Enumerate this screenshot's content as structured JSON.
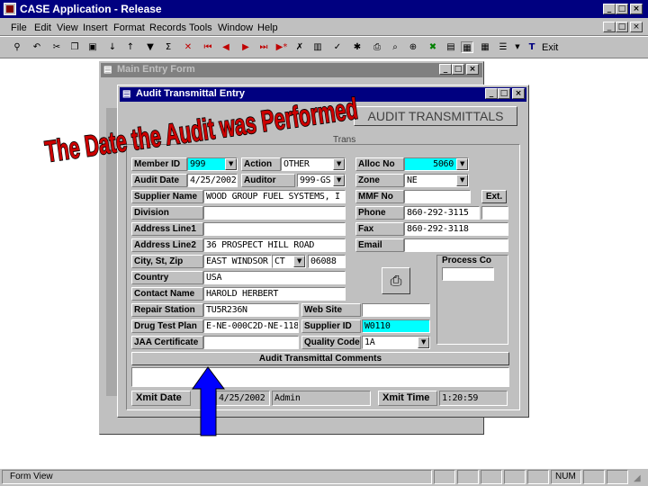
{
  "app": {
    "title": "CASE Application - Release"
  },
  "menu": [
    "File",
    "Edit",
    "View",
    "Insert",
    "Format",
    "Records",
    "Tools",
    "Window",
    "Help"
  ],
  "toolbar": {
    "exit_label": "Exit"
  },
  "main_form": {
    "title": "Main Entry Form"
  },
  "audit_window": {
    "title": "Audit Transmittal Entry",
    "header": "AUDIT TRANSMITTALS",
    "behind_text_1": "al",
    "behind_text_2": "Trans"
  },
  "overlay": {
    "caption": "The Date the Audit was Performed",
    "color": "#cc0000",
    "arrow_color": "#0000ff"
  },
  "fields": {
    "member_id": {
      "label": "Member ID",
      "value": "999"
    },
    "action": {
      "label": "Action",
      "value": "OTHER"
    },
    "alloc_no": {
      "label": "Alloc No",
      "value": "5060"
    },
    "audit_date": {
      "label": "Audit Date",
      "value": "4/25/2002"
    },
    "auditor": {
      "label": "Auditor",
      "value": "999-GS"
    },
    "zone": {
      "label": "Zone",
      "value": "NE"
    },
    "supplier_name": {
      "label": "Supplier Name",
      "value": "WOOD GROUP FUEL SYSTEMS, I"
    },
    "mmf_no": {
      "label": "MMF No",
      "value": ""
    },
    "ext_label": "Ext.",
    "division": {
      "label": "Division",
      "value": ""
    },
    "phone": {
      "label": "Phone",
      "value": "860-292-3115"
    },
    "address1": {
      "label": "Address Line1",
      "value": ""
    },
    "fax": {
      "label": "Fax",
      "value": "860-292-3118"
    },
    "address2": {
      "label": "Address Line2",
      "value": "36 PROSPECT HILL ROAD"
    },
    "email": {
      "label": "Email",
      "value": ""
    },
    "city_st_zip": {
      "label": "City, St, Zip",
      "city": "EAST WINDSOR",
      "state": "CT",
      "zip": "06088"
    },
    "process_co": {
      "label": "Process Co",
      "value": ""
    },
    "country": {
      "label": "Country",
      "value": "USA"
    },
    "contact_name": {
      "label": "Contact Name",
      "value": "HAROLD HERBERT"
    },
    "repair_station": {
      "label": "Repair Station",
      "value": "TU5R236N"
    },
    "web_site": {
      "label": "Web Site",
      "value": ""
    },
    "drug_test_plan": {
      "label": "Drug Test Plan",
      "value": "E-NE-000C2D-NE-118"
    },
    "supplier_id": {
      "label": "Supplier ID",
      "value": "W0110"
    },
    "jaa_cert": {
      "label": "JAA Certificate",
      "value": ""
    },
    "quality_code": {
      "label": "Quality Code",
      "value": "1A"
    },
    "comments_header": "Audit Transmittal Comments",
    "comments_value": "",
    "xmit_date": {
      "label": "Xmit Date",
      "value": "4/25/2002",
      "user": "Admin"
    },
    "xmit_time": {
      "label": "Xmit Time",
      "value": "1:20:59"
    }
  },
  "status_bar": {
    "left": "Form View",
    "num": "NUM"
  }
}
